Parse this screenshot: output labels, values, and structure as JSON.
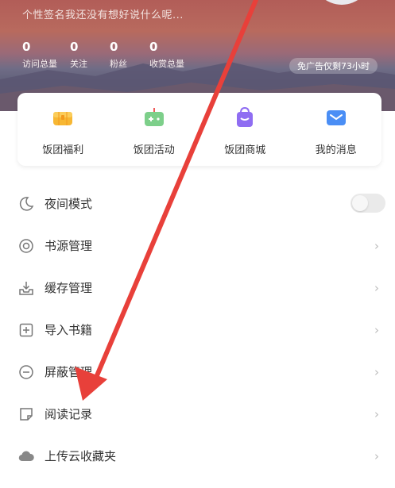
{
  "profile": {
    "signature": "个性签名我还没有想好说什么呢...",
    "stats": [
      {
        "value": "0",
        "label": "访问总量"
      },
      {
        "value": "0",
        "label": "关注"
      },
      {
        "value": "0",
        "label": "粉丝"
      },
      {
        "value": "0",
        "label": "收赏总量"
      }
    ],
    "ad_free": "免广告仅剩73小时"
  },
  "quick_entries": [
    {
      "label": "饭团福利",
      "icon": "treasure-chest-icon"
    },
    {
      "label": "饭团活动",
      "icon": "game-controller-icon"
    },
    {
      "label": "饭团商城",
      "icon": "shopping-bag-icon"
    },
    {
      "label": "我的消息",
      "icon": "envelope-icon"
    }
  ],
  "menu": [
    {
      "label": "夜间模式",
      "icon": "moon-icon",
      "control": "toggle",
      "on": false
    },
    {
      "label": "书源管理",
      "icon": "target-icon",
      "control": "chevron"
    },
    {
      "label": "缓存管理",
      "icon": "download-tray-icon",
      "control": "chevron"
    },
    {
      "label": "导入书籍",
      "icon": "import-file-icon",
      "control": "chevron"
    },
    {
      "label": "屏蔽管理",
      "icon": "block-icon",
      "control": "chevron"
    },
    {
      "label": "阅读记录",
      "icon": "note-icon",
      "control": "chevron"
    },
    {
      "label": "上传云收藏夹",
      "icon": "cloud-icon",
      "control": "chevron"
    }
  ],
  "colors": {
    "arrow": "#e8403a",
    "welfare": "#f7b733",
    "activity": "#7dcf8a",
    "mall": "#8f6df2",
    "message": "#4a8ef5"
  }
}
